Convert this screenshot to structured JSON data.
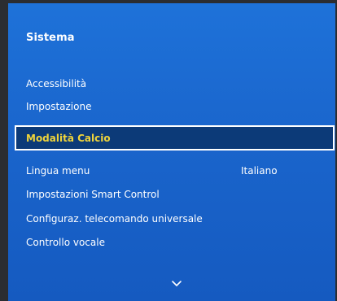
{
  "menu": {
    "title": "Sistema",
    "items": [
      {
        "label": "Accessibilità"
      },
      {
        "label": "Impostazione"
      },
      {
        "label": "Modalità Calcio"
      },
      {
        "label": "Lingua menu",
        "value": "Italiano"
      },
      {
        "label": "Impostazioni Smart Control"
      },
      {
        "label": "Configuraz. telecomando universale"
      },
      {
        "label": "Controllo vocale"
      }
    ],
    "selected_index": 2,
    "scroll_icon": "chevron-down-icon"
  },
  "colors": {
    "panel": "#1a65cc",
    "focus_background": "#0c3a78",
    "focus_text": "#f0d43a",
    "frame": "#2b2d31"
  }
}
